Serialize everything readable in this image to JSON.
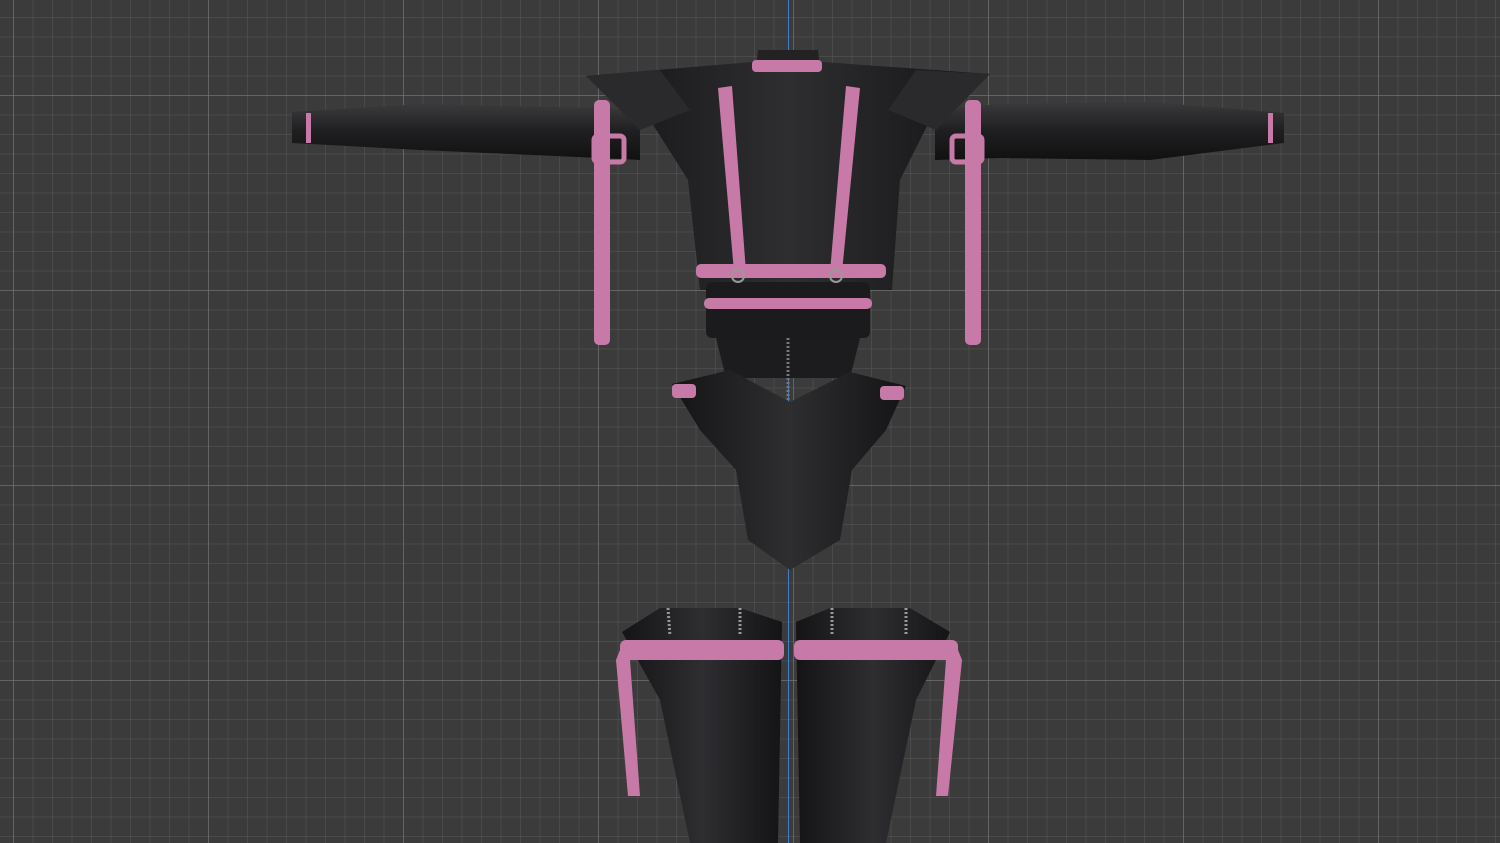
{
  "viewport": {
    "colors": {
      "background": "#3b3b3b",
      "axis_line": "#3f7fc9",
      "leather": "#1c1c1e",
      "strap": "#c77aa8"
    },
    "icons": [
      "garment-model"
    ]
  }
}
